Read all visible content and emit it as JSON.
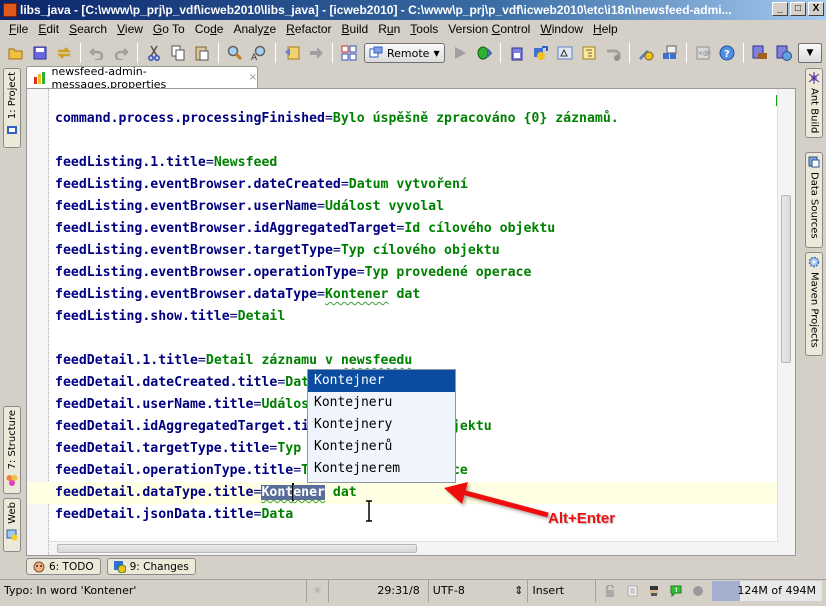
{
  "window": {
    "title": "libs_java - [C:\\www\\p_prj\\p_vdf\\icweb2010\\libs_java] - [icweb2010] - C:\\www\\p_prj\\p_vdf\\icweb2010\\etc\\i18n\\newsfeed-admi...",
    "controls": {
      "minimize": "_",
      "maximize": "□",
      "close": "X"
    }
  },
  "menu": [
    {
      "label": "File",
      "mnemonic": "F"
    },
    {
      "label": "Edit",
      "mnemonic": "E"
    },
    {
      "label": "Search",
      "mnemonic": "S"
    },
    {
      "label": "View",
      "mnemonic": "V"
    },
    {
      "label": "Go To",
      "mnemonic": "G"
    },
    {
      "label": "Code",
      "mnemonic": "d"
    },
    {
      "label": "Analyze",
      "mnemonic": "z"
    },
    {
      "label": "Refactor",
      "mnemonic": "R"
    },
    {
      "label": "Build",
      "mnemonic": "B"
    },
    {
      "label": "Run",
      "mnemonic": "u"
    },
    {
      "label": "Tools",
      "mnemonic": "T"
    },
    {
      "label": "Version Control",
      "mnemonic": "C"
    },
    {
      "label": "Window",
      "mnemonic": "W"
    },
    {
      "label": "Help",
      "mnemonic": "H"
    }
  ],
  "toolbar": {
    "run_config": "Remote",
    "icons": [
      "open-folder",
      "save-all",
      "synchronize",
      "undo",
      "redo",
      "cut",
      "copy",
      "paste",
      "find",
      "replace",
      "back",
      "forward",
      "structure-view",
      "run",
      "debug",
      "make-module",
      "compile",
      "diagram",
      "hierarchy",
      "rollback",
      "settings",
      "project-structure",
      "web-services",
      "help",
      "plugin-memory",
      "plugin-web"
    ]
  },
  "left_tools": [
    {
      "label": "1: Project"
    },
    {
      "label": "7: Structure"
    },
    {
      "label": "Web"
    }
  ],
  "right_tools": [
    {
      "label": "Ant Build"
    },
    {
      "label": "Data Sources"
    },
    {
      "label": "Maven Projects"
    }
  ],
  "editor": {
    "tab": {
      "filename": "newsfeed-admin-messages.properties",
      "close": "×"
    },
    "lines": [
      {
        "key": "command.process.processingFinished",
        "value": "Bylo úspěšně zpracováno {0} záznamů."
      },
      {
        "key": "",
        "value": ""
      },
      {
        "key": "feedListing.1.title",
        "value": "Newsfeed"
      },
      {
        "key": "feedListing.eventBrowser.dateCreated",
        "value": "Datum vytvoření"
      },
      {
        "key": "feedListing.eventBrowser.userName",
        "value": "Událost vyvolal"
      },
      {
        "key": "feedListing.eventBrowser.idAggregatedTarget",
        "value": "Id cílového objektu"
      },
      {
        "key": "feedListing.eventBrowser.targetType",
        "value": "Typ cílového objektu"
      },
      {
        "key": "feedListing.eventBrowser.operationType",
        "value": "Typ provedené operace"
      },
      {
        "key": "feedListing.eventBrowser.dataType",
        "value_typo": "Kontener",
        "value_rest": " dat"
      },
      {
        "key": "feedListing.show.title",
        "value": "Detail"
      },
      {
        "key": "",
        "value": ""
      },
      {
        "key": "feedDetail.1.title",
        "value_pre": "Detail záznamu v ",
        "value_typo": "newsfeedu"
      },
      {
        "key": "feedDetail.dateCreated.title",
        "value": "Datum vytvoření"
      },
      {
        "key": "feedDetail.userName.title",
        "value": "Událost vyvolal"
      },
      {
        "key": "feedDetail.idAggregatedTarget.title",
        "value": "Id cílového objektu"
      },
      {
        "key": "feedDetail.targetType.title",
        "value": "Typ cílového objektu"
      },
      {
        "key": "feedDetail.operationType.title",
        "value": "Typ provedené operace"
      },
      {
        "key": "feedDetail.dataType.title",
        "value_sel_a": "Kont",
        "value_sel_b": "ener",
        "value_rest": " dat"
      },
      {
        "key": "feedDetail.jsonData.title",
        "value": "Data"
      }
    ],
    "eq": "="
  },
  "completion_popup": {
    "items": [
      "Kontejner",
      "Kontejneru",
      "Kontejnery",
      "Kontejnerů",
      "Kontejnerem"
    ],
    "selected_index": 0
  },
  "annotation": {
    "label": "Alt+Enter",
    "color": "#ee1111"
  },
  "bottom_tools": [
    {
      "label": "6: TODO"
    },
    {
      "label": "9: Changes"
    }
  ],
  "status": {
    "message": "Typo: In word 'Kontener'",
    "position": "29:31/8",
    "encoding": "UTF-8",
    "encoding_arrow": "⇕",
    "mode": "Insert",
    "memory": {
      "used": "124M",
      "of": "of 494M",
      "fraction": 0.251
    }
  },
  "colors": {
    "key": "#000080",
    "value": "#008000",
    "selection": "#5a6d9a",
    "popup_selected": "#0a4ca0",
    "current_line": "#ffffe4",
    "inspection_ok": "#22dd22"
  }
}
